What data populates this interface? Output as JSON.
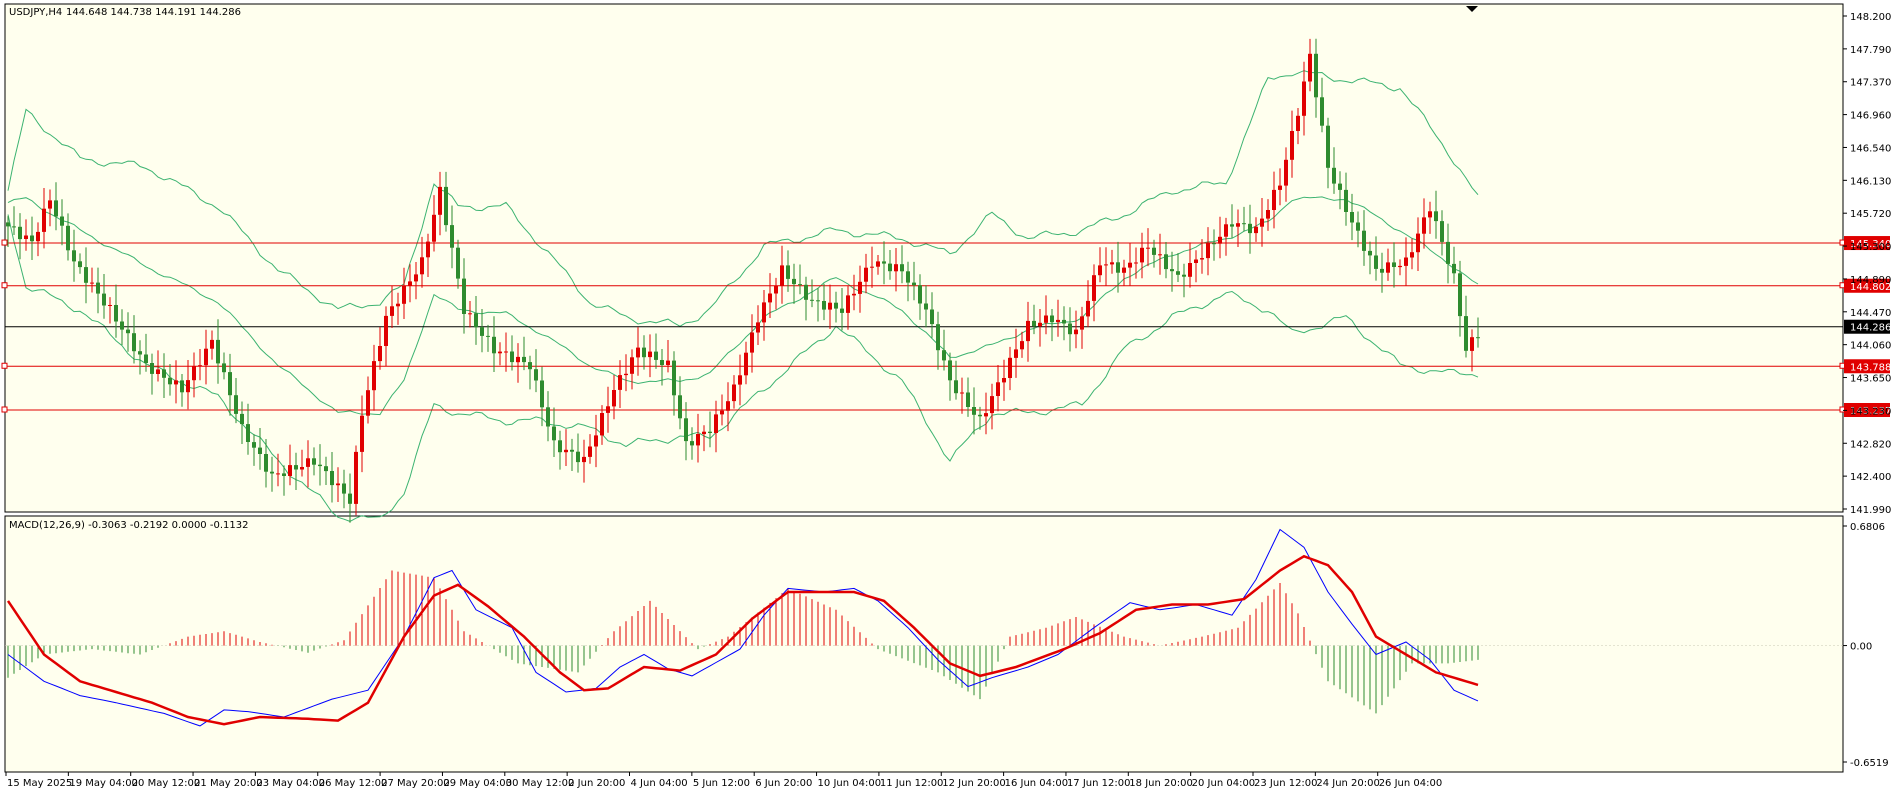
{
  "chart_data": {
    "type": "candlestick",
    "title": "USDJPY,H4",
    "ohlc_header": "144.648 144.738 144.191 144.286",
    "price_axis": {
      "ylim": [
        141.99,
        148.2
      ],
      "ticks": [
        "148.200",
        "147.790",
        "147.370",
        "146.960",
        "146.540",
        "146.130",
        "145.720",
        "145.300",
        "144.890",
        "144.470",
        "144.060",
        "143.650",
        "143.230",
        "142.820",
        "142.400",
        "141.990"
      ]
    },
    "current_price": "144.286",
    "levels": [
      "145.340",
      "144.802",
      "143.788",
      "143.237"
    ],
    "x_labels": [
      "15 May 2025",
      "19 May 04:00",
      "20 May 12:00",
      "21 May 20:00",
      "23 May 04:00",
      "26 May 12:00",
      "27 May 20:00",
      "29 May 04:00",
      "30 May 12:00",
      "2 Jun 20:00",
      "4 Jun 04:00",
      "5 Jun 12:00",
      "6 Jun 20:00",
      "10 Jun 04:00",
      "11 Jun 12:00",
      "12 Jun 20:00",
      "16 Jun 04:00",
      "17 Jun 12:00",
      "18 Jun 20:00",
      "20 Jun 04:00",
      "23 Jun 12:00",
      "24 Jun 20:00",
      "26 Jun 04:00"
    ],
    "bollinger_control": [
      [
        0,
        146.0,
        145.85,
        145.7
      ],
      [
        3,
        147.0,
        145.9,
        144.8
      ],
      [
        12,
        146.4,
        145.5,
        144.5
      ],
      [
        23,
        146.3,
        145.05,
        143.8
      ],
      [
        35,
        145.8,
        144.6,
        143.4
      ],
      [
        45,
        145.0,
        143.8,
        142.6
      ],
      [
        55,
        144.5,
        143.2,
        141.9
      ],
      [
        62,
        144.6,
        143.2,
        141.85
      ],
      [
        66,
        144.8,
        143.6,
        142.2
      ],
      [
        71,
        146.1,
        144.7,
        143.3
      ],
      [
        75,
        145.8,
        144.5,
        143.2
      ],
      [
        83,
        145.8,
        144.45,
        143.1
      ],
      [
        89,
        145.3,
        144.2,
        143.1
      ],
      [
        97,
        144.6,
        143.8,
        143.0
      ],
      [
        103,
        144.4,
        143.6,
        142.8
      ],
      [
        112,
        144.3,
        143.6,
        142.9
      ],
      [
        117,
        144.5,
        143.7,
        142.9
      ],
      [
        126,
        145.3,
        144.4,
        143.5
      ],
      [
        138,
        145.5,
        144.9,
        144.3
      ],
      [
        149,
        145.4,
        144.5,
        143.6
      ],
      [
        157,
        145.2,
        143.9,
        142.6
      ],
      [
        164,
        145.7,
        144.05,
        143.2
      ],
      [
        170,
        145.4,
        144.25,
        143.2
      ],
      [
        179,
        145.5,
        144.4,
        143.3
      ],
      [
        186,
        145.7,
        144.9,
        144.0
      ],
      [
        194,
        146.0,
        145.2,
        144.4
      ],
      [
        203,
        146.1,
        145.4,
        144.7
      ],
      [
        210,
        147.4,
        145.6,
        144.5
      ],
      [
        214,
        147.5,
        145.9,
        144.2
      ],
      [
        223,
        147.4,
        145.9,
        144.4
      ],
      [
        232,
        147.3,
        145.5,
        143.8
      ],
      [
        240,
        146.5,
        145.1,
        143.7
      ],
      [
        245,
        145.9,
        144.8,
        143.7
      ]
    ],
    "macd": {
      "label": "MACD(12,26,9) -0.3063 -0.2192 0.0000 -0.1132",
      "ylim": [
        -0.6519,
        0.6806
      ],
      "ticks": [
        "0.6806",
        "0.00",
        "-0.6519"
      ],
      "hist_control": [
        [
          0,
          -0.18
        ],
        [
          6,
          -0.05
        ],
        [
          14,
          -0.02
        ],
        [
          22,
          -0.05
        ],
        [
          30,
          0.05
        ],
        [
          36,
          0.08
        ],
        [
          42,
          0.02
        ],
        [
          50,
          -0.04
        ],
        [
          56,
          0.03
        ],
        [
          64,
          0.42
        ],
        [
          71,
          0.38
        ],
        [
          76,
          0.08
        ],
        [
          85,
          -0.1
        ],
        [
          95,
          -0.15
        ],
        [
          101,
          0.08
        ],
        [
          107,
          0.25
        ],
        [
          115,
          -0.02
        ],
        [
          120,
          0.05
        ],
        [
          130,
          0.32
        ],
        [
          138,
          0.2
        ],
        [
          145,
          -0.02
        ],
        [
          155,
          -0.15
        ],
        [
          162,
          -0.3
        ],
        [
          167,
          0.05
        ],
        [
          173,
          0.1
        ],
        [
          178,
          0.16
        ],
        [
          186,
          0.05
        ],
        [
          192,
          0.0
        ],
        [
          199,
          0.05
        ],
        [
          205,
          0.1
        ],
        [
          212,
          0.35
        ],
        [
          215,
          0.18
        ],
        [
          220,
          -0.2
        ],
        [
          228,
          -0.38
        ],
        [
          234,
          -0.1
        ],
        [
          240,
          -0.1
        ],
        [
          245,
          -0.08
        ]
      ],
      "macd_control": [
        [
          0,
          -0.05
        ],
        [
          6,
          -0.2
        ],
        [
          12,
          -0.28
        ],
        [
          18,
          -0.32
        ],
        [
          26,
          -0.38
        ],
        [
          32,
          -0.45
        ],
        [
          36,
          -0.36
        ],
        [
          40,
          -0.37
        ],
        [
          46,
          -0.4
        ],
        [
          54,
          -0.3
        ],
        [
          60,
          -0.25
        ],
        [
          66,
          0.05
        ],
        [
          71,
          0.38
        ],
        [
          74,
          0.42
        ],
        [
          78,
          0.2
        ],
        [
          84,
          0.1
        ],
        [
          88,
          -0.15
        ],
        [
          93,
          -0.26
        ],
        [
          98,
          -0.24
        ],
        [
          102,
          -0.12
        ],
        [
          106,
          -0.05
        ],
        [
          110,
          -0.13
        ],
        [
          114,
          -0.17
        ],
        [
          122,
          -0.02
        ],
        [
          126,
          0.17
        ],
        [
          130,
          0.32
        ],
        [
          136,
          0.3
        ],
        [
          141,
          0.32
        ],
        [
          145,
          0.25
        ],
        [
          150,
          0.1
        ],
        [
          155,
          -0.08
        ],
        [
          160,
          -0.23
        ],
        [
          164,
          -0.18
        ],
        [
          170,
          -0.12
        ],
        [
          175,
          -0.05
        ],
        [
          181,
          0.1
        ],
        [
          187,
          0.24
        ],
        [
          192,
          0.2
        ],
        [
          198,
          0.23
        ],
        [
          204,
          0.17
        ],
        [
          208,
          0.37
        ],
        [
          212,
          0.65
        ],
        [
          216,
          0.55
        ],
        [
          220,
          0.3
        ],
        [
          224,
          0.12
        ],
        [
          228,
          -0.05
        ],
        [
          233,
          0.02
        ],
        [
          237,
          -0.08
        ],
        [
          241,
          -0.25
        ],
        [
          245,
          -0.31
        ]
      ],
      "signal_control": [
        [
          0,
          0.25
        ],
        [
          6,
          -0.05
        ],
        [
          12,
          -0.2
        ],
        [
          18,
          -0.26
        ],
        [
          24,
          -0.32
        ],
        [
          30,
          -0.4
        ],
        [
          36,
          -0.44
        ],
        [
          42,
          -0.4
        ],
        [
          50,
          -0.41
        ],
        [
          55,
          -0.42
        ],
        [
          60,
          -0.32
        ],
        [
          66,
          0.05
        ],
        [
          71,
          0.28
        ],
        [
          75,
          0.34
        ],
        [
          80,
          0.22
        ],
        [
          86,
          0.05
        ],
        [
          92,
          -0.15
        ],
        [
          96,
          -0.25
        ],
        [
          100,
          -0.24
        ],
        [
          106,
          -0.12
        ],
        [
          112,
          -0.14
        ],
        [
          118,
          -0.05
        ],
        [
          124,
          0.15
        ],
        [
          130,
          0.3
        ],
        [
          136,
          0.3
        ],
        [
          141,
          0.3
        ],
        [
          146,
          0.25
        ],
        [
          151,
          0.1
        ],
        [
          157,
          -0.1
        ],
        [
          162,
          -0.17
        ],
        [
          168,
          -0.12
        ],
        [
          176,
          -0.02
        ],
        [
          182,
          0.07
        ],
        [
          188,
          0.2
        ],
        [
          194,
          0.23
        ],
        [
          200,
          0.23
        ],
        [
          206,
          0.26
        ],
        [
          212,
          0.42
        ],
        [
          216,
          0.5
        ],
        [
          220,
          0.45
        ],
        [
          224,
          0.3
        ],
        [
          228,
          0.05
        ],
        [
          233,
          -0.05
        ],
        [
          238,
          -0.15
        ],
        [
          245,
          -0.22
        ]
      ]
    }
  }
}
